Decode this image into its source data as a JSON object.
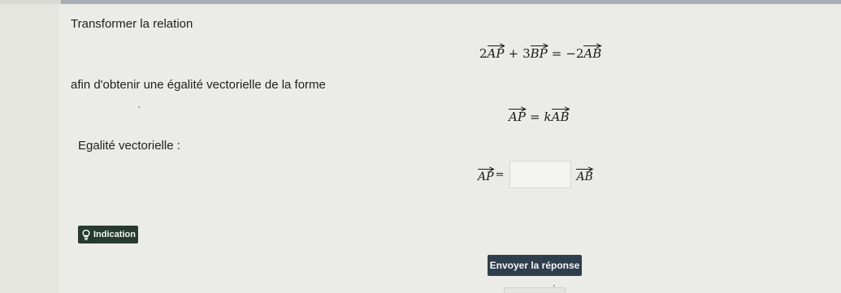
{
  "exercise": {
    "instruction": "Transformer la relation",
    "relation": {
      "term1_coef": "2",
      "term1_vec": "AP",
      "plus": "+",
      "term2_coef": "3",
      "term2_vec": "BP",
      "equals": "=",
      "rhs_coef": "−2",
      "rhs_vec": "AB"
    },
    "goal_text": "afin d'obtenir une égalité vectorielle de la forme",
    "form": {
      "lhs_vec": "AP",
      "equals": "=",
      "coef": "k",
      "rhs_vec": "AB"
    },
    "answer_label": "Egalité vectorielle :",
    "answer": {
      "lhs_vec": "AP",
      "equals": "=",
      "input_value": "",
      "rhs_vec": "AB"
    }
  },
  "buttons": {
    "hint_label": "Indication",
    "submit_label": "Envoyer la réponse"
  },
  "colors": {
    "background": "#e6e6e1",
    "hint_button": "#243b2d",
    "submit_button": "#2f3e4d",
    "top_bar": "#a7aeb7"
  },
  "icons": {
    "hint": "lightbulb-icon",
    "vector": "vector-arrow-icon"
  }
}
